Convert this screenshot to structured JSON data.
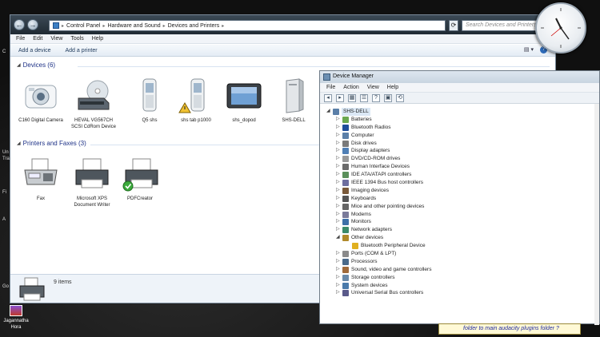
{
  "explorer": {
    "breadcrumb": [
      "Control Panel",
      "Hardware and Sound",
      "Devices and Printers"
    ],
    "search_placeholder": "Search Devices and Printers",
    "menu": [
      "File",
      "Edit",
      "View",
      "Tools",
      "Help"
    ],
    "toolbar": [
      "Add a device",
      "Add a printer"
    ],
    "devices_header": "Devices (6)",
    "devices": [
      {
        "label": "C160 Digital Camera",
        "icon": "camera-icon"
      },
      {
        "label": "HEVAL VG567CH SCSI CdRom Device",
        "icon": "cdrom-icon"
      },
      {
        "label": "Q5 shs",
        "icon": "phone-icon"
      },
      {
        "label": "shs tab p1000",
        "icon": "phone-icon"
      },
      {
        "label": "shs_dopod",
        "icon": "pda-icon"
      },
      {
        "label": "SHS-DELL",
        "icon": "computer-tower-icon"
      }
    ],
    "printers_header": "Printers and Faxes (3)",
    "printers": [
      {
        "label": "Fax",
        "icon": "fax-icon"
      },
      {
        "label": "Microsoft XPS Document Writer",
        "icon": "printer-icon"
      },
      {
        "label": "PDFCreator",
        "icon": "printer-icon"
      }
    ],
    "status": "9 items"
  },
  "device_manager": {
    "title": "Device Manager",
    "menu": [
      "File",
      "Action",
      "View",
      "Help"
    ],
    "root": "SHS-DELL",
    "categories": [
      {
        "label": "Batteries",
        "color": "#6aa84f"
      },
      {
        "label": "Bluetooth Radios",
        "color": "#1f4e9b"
      },
      {
        "label": "Computer",
        "color": "#5b7fa8"
      },
      {
        "label": "Disk drives",
        "color": "#7a7a7a"
      },
      {
        "label": "Display adapters",
        "color": "#4f7fb5"
      },
      {
        "label": "DVD/CD-ROM drives",
        "color": "#999999"
      },
      {
        "label": "Human Interface Devices",
        "color": "#6a6a6a"
      },
      {
        "label": "IDE ATA/ATAPI controllers",
        "color": "#5a8f5a"
      },
      {
        "label": "IEEE 1394 Bus host controllers",
        "color": "#6f6f9f"
      },
      {
        "label": "Imaging devices",
        "color": "#7a5a3a"
      },
      {
        "label": "Keyboards",
        "color": "#555555"
      },
      {
        "label": "Mice and other pointing devices",
        "color": "#666666"
      },
      {
        "label": "Modems",
        "color": "#7a7a9a"
      },
      {
        "label": "Monitors",
        "color": "#3d6fa8"
      },
      {
        "label": "Network adapters",
        "color": "#3b8a6a"
      },
      {
        "label": "Other devices",
        "color": "#b08a2a",
        "expanded": true
      },
      {
        "label": "Bluetooth Peripheral Device",
        "color": "#e0b020",
        "child": true
      },
      {
        "label": "Ports (COM & LPT)",
        "color": "#8a8a8a"
      },
      {
        "label": "Processors",
        "color": "#4a6a8a"
      },
      {
        "label": "Sound, video and game controllers",
        "color": "#a06a3a"
      },
      {
        "label": "Storage controllers",
        "color": "#6a8aaa"
      },
      {
        "label": "System devices",
        "color": "#4a7aaa"
      },
      {
        "label": "Universal Serial Bus controllers",
        "color": "#5a5a8a"
      }
    ]
  },
  "desktop": {
    "icon_label": "Jagannatha Hora",
    "tooltip": "folder to main audacity plugins folder ?",
    "side_letters": [
      "C",
      "Un",
      "Tra",
      "Fi",
      "A",
      "Go"
    ]
  }
}
